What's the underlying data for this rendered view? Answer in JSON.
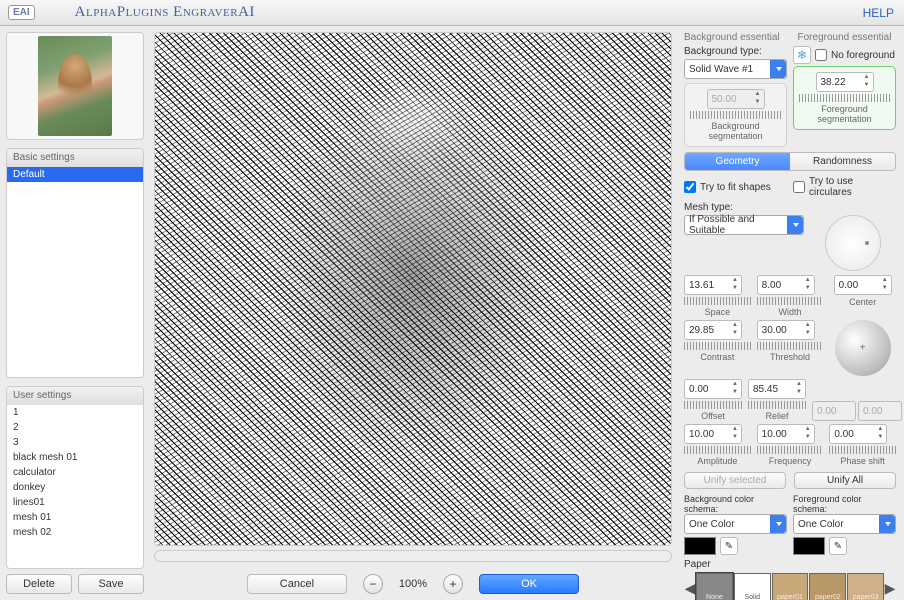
{
  "header": {
    "logo": "EAI",
    "title": "AlphaPlugins EngraverAI",
    "help": "HELP"
  },
  "basic": {
    "header": "Basic settings",
    "items": [
      "Default"
    ]
  },
  "user": {
    "header": "User settings",
    "items": [
      "1",
      "2",
      "3",
      "black mesh 01",
      "calculator",
      "donkey",
      "lines01",
      "mesh 01",
      "mesh 02"
    ],
    "delete": "Delete",
    "save": "Save"
  },
  "footer": {
    "cancel": "Cancel",
    "zoom": "100%",
    "ok": "OK"
  },
  "bg": {
    "section": "Background essential",
    "type_label": "Background type:",
    "type_value": "Solid Wave #1",
    "seg_value": "50.00",
    "seg_label": "Background segmentation"
  },
  "fg": {
    "section": "Foreground essential",
    "nofg": "No foreground",
    "seg_value": "38.22",
    "seg_label": "Foreground segmentation"
  },
  "tabs": {
    "geometry": "Geometry",
    "randomness": "Randomness"
  },
  "checks": {
    "fit": "Try to fit shapes",
    "circ": "Try to use circulares"
  },
  "mesh": {
    "label": "Mesh type:",
    "value": "If Possible and Suitable"
  },
  "params": {
    "space": {
      "v": "13.61",
      "l": "Space"
    },
    "width": {
      "v": "8.00",
      "l": "Width"
    },
    "center": {
      "v": "0.00",
      "l": "Center"
    },
    "contrast": {
      "v": "29.85",
      "l": "Contrast"
    },
    "threshold": {
      "v": "30.00",
      "l": "Threshold"
    },
    "offset": {
      "v": "0.00",
      "l": "Offset"
    },
    "relief": {
      "v": "85.45",
      "l": "Relief"
    },
    "cx": "0.00",
    "cy": "0.00",
    "amplitude": {
      "v": "10.00",
      "l": "Amplitude"
    },
    "frequency": {
      "v": "10.00",
      "l": "Frequency"
    },
    "phase": {
      "v": "0.00",
      "l": "Phase shift"
    }
  },
  "unify": {
    "sel": "Unify selected",
    "all": "Unify All"
  },
  "schema": {
    "bg_label": "Background color schema:",
    "fg_label": "Foreground color schema:",
    "value": "One Color"
  },
  "paper": {
    "label": "Paper",
    "items": [
      "None",
      "Solid",
      "paper01",
      "paper02",
      "paper03"
    ]
  }
}
